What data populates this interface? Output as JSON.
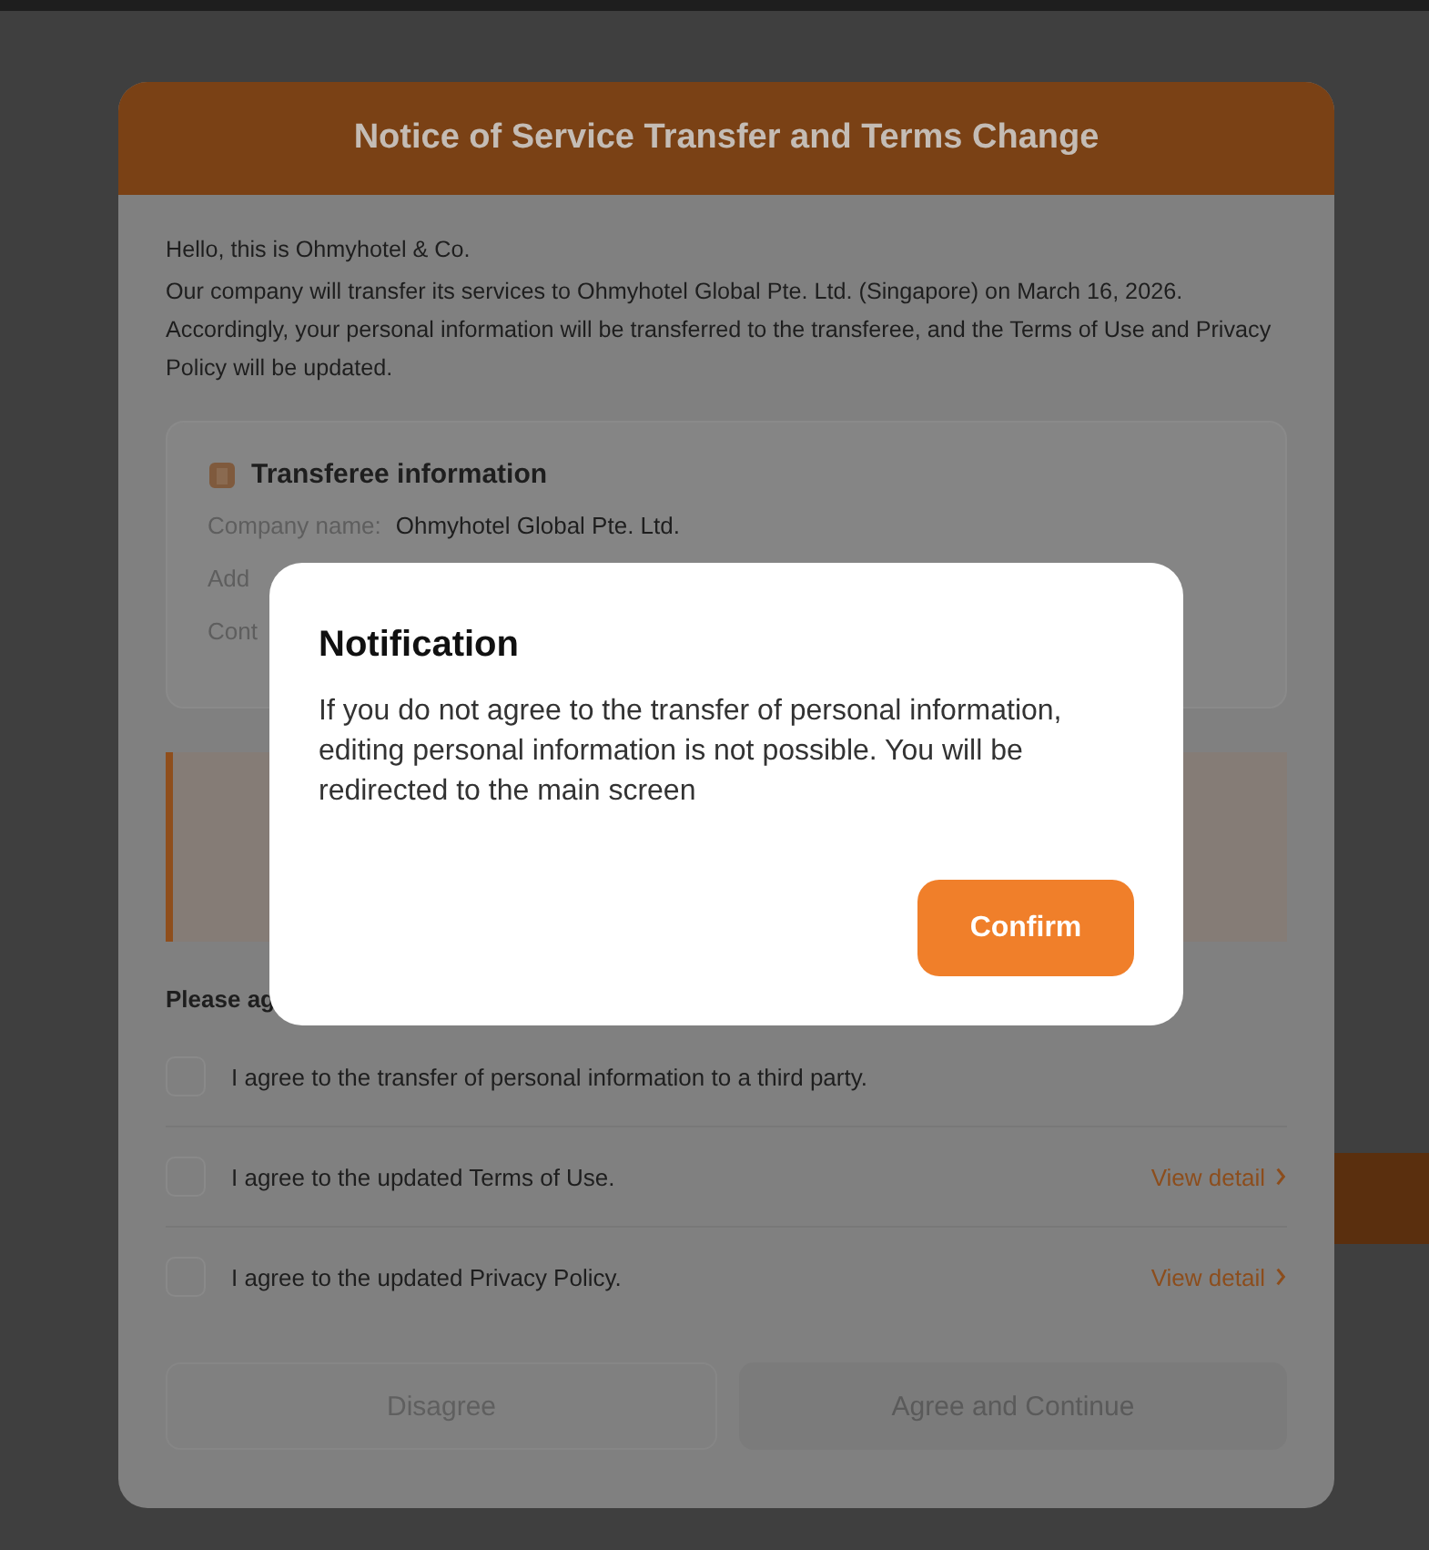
{
  "notice_modal": {
    "title": "Notice of Service Transfer and Terms Change",
    "greeting": "Hello, this is Ohmyhotel & Co.",
    "message": "Our company will transfer its services to Ohmyhotel Global Pte. Ltd. (Singapore) on March 16, 2026. Accordingly, your personal information will be transferred to the transferee, and the Terms of Use and Privacy Policy will be updated.",
    "info_box": {
      "title": "Transferee information",
      "rows": [
        {
          "label": "Company name:",
          "value": "Ohmyhotel Global Pte. Ltd."
        },
        {
          "label": "Add"
        },
        {
          "label": "Cont"
        }
      ]
    },
    "agreements_heading": "Please ag",
    "agreements": [
      {
        "label": "I agree to the transfer of personal information to a third party.",
        "checked": false
      },
      {
        "label": "I agree to the updated Terms of Use.",
        "checked": false,
        "link": "View detail"
      },
      {
        "label": "I agree to the updated Privacy Policy.",
        "checked": false,
        "link": "View detail"
      }
    ],
    "buttons": [
      {
        "label": "Disagree",
        "kind": "secondary"
      },
      {
        "label": "Agree and Continue",
        "kind": "primary",
        "disabled": true
      }
    ]
  },
  "notification_dialog": {
    "title": "Notification",
    "message": "If you do not agree to the transfer of personal information, editing personal information is not possible. You will be redirected to the main screen",
    "button": "Confirm"
  }
}
